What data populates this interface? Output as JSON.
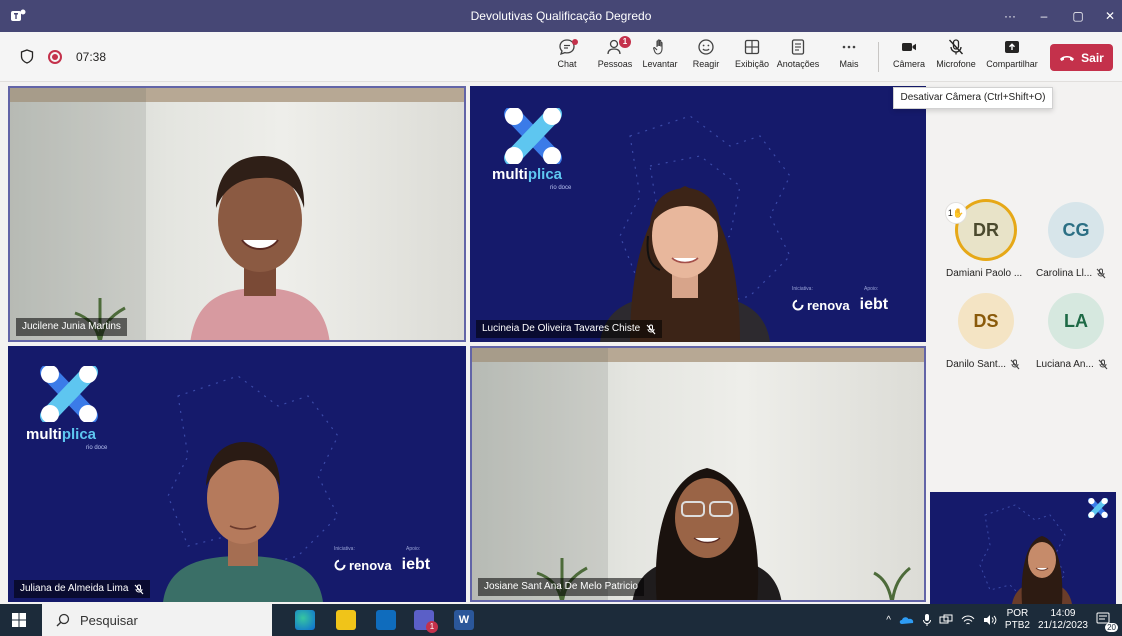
{
  "window": {
    "title": "Devolutivas Qualificação Degredo",
    "more": "···",
    "minimize": "–",
    "restore": "▢",
    "close": "✕"
  },
  "toolbar": {
    "timer": "07:38",
    "buttons": {
      "chat": "Chat",
      "people": "Pessoas",
      "people_count": "1",
      "raise": "Levantar",
      "react": "Reagir",
      "view": "Exibição",
      "notes": "Anotações",
      "more": "Mais",
      "camera": "Câmera",
      "mic": "Microfone",
      "share": "Compartilhar"
    },
    "leave": "Sair",
    "tooltip": "Desativar Câmera (Ctrl+Shift+O)"
  },
  "tiles": [
    {
      "name": "Jucilene Junia Martins",
      "muted": false
    },
    {
      "name": "Lucineia De Oliveira Tavares Chiste",
      "muted": true
    },
    {
      "name": "Juliana de Almeida Lima",
      "muted": true
    },
    {
      "name": "Josiane Sant Ana De Melo Patricio",
      "muted": false
    }
  ],
  "brand": {
    "prefix": "multi",
    "highlight": "plica",
    "subtitle": "rio doce",
    "initiative_label": "Iniciativa:",
    "support_label": "Apoio:",
    "renova_small": "FUNDAÇÃO",
    "renova": "renova",
    "iebt": "iebt"
  },
  "participants": [
    {
      "initials": "DR",
      "name": "Damiani Paolo ...",
      "bg": "#e8e3c8",
      "fg": "#4b4a2e",
      "hand": "1",
      "muted": false
    },
    {
      "initials": "CG",
      "name": "Carolina Ll...",
      "bg": "#d7e5ea",
      "fg": "#2b6f84",
      "muted": true
    },
    {
      "initials": "DS",
      "name": "Danilo Sant...",
      "bg": "#f4e4c4",
      "fg": "#8a5a0a",
      "muted": true
    },
    {
      "initials": "LA",
      "name": "Luciana An...",
      "bg": "#d6e8df",
      "fg": "#1e6a46",
      "muted": true
    }
  ],
  "taskbar": {
    "search": "Pesquisar",
    "lang": "POR",
    "layout": "PTB2",
    "time": "14:09",
    "date": "21/12/2023",
    "notif": "20",
    "teams_badge": "1"
  },
  "colors": {
    "title_bar": "#464775",
    "accent": "#6264a7",
    "leave": "#c4314b",
    "brand_bg": "#151a6b"
  }
}
